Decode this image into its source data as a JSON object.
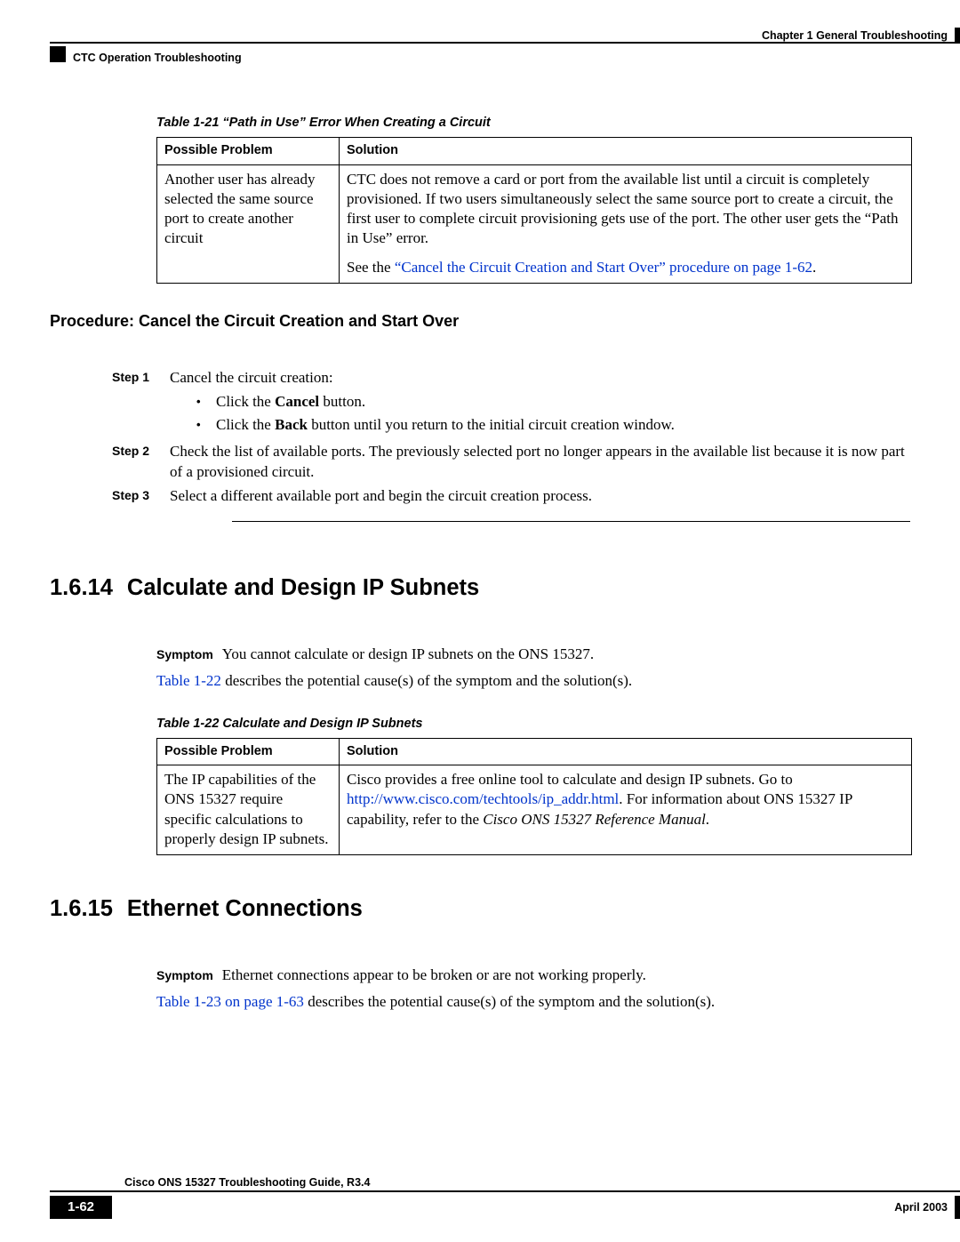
{
  "header": {
    "chapter": "Chapter 1      General Troubleshooting",
    "section": "CTC Operation Troubleshooting"
  },
  "table21": {
    "caption": "Table 1-21    “Path in Use” Error When Creating a Circuit",
    "th1": "Possible Problem",
    "th2": "Solution",
    "problem": "Another user has already selected the same source port to create another circuit",
    "solution1": "CTC does not remove a card or port from the available list until a circuit is completely provisioned. If two users simultaneously select the same source port to create a circuit, the first user to complete circuit provisioning gets use of the port. The other user gets the “Path in Use” error.",
    "solution2_pre": "See the ",
    "solution2_link": "“Cancel the Circuit Creation and Start Over” procedure on page 1-62",
    "solution2_post": "."
  },
  "procedure": {
    "title": "Procedure: Cancel the Circuit Creation and Start Over",
    "step1_label": "Step 1",
    "step1_text": "Cancel the circuit creation:",
    "step1_b1_pre": "Click the ",
    "step1_b1_bold": "Cancel",
    "step1_b1_post": " button.",
    "step1_b2_pre": "Click the ",
    "step1_b2_bold": "Back",
    "step1_b2_post": " button until you return to the initial circuit creation window.",
    "step2_label": "Step 2",
    "step2_text": "Check the list of available ports. The previously selected port no longer appears in the available list because it is now part of a provisioned circuit.",
    "step3_label": "Step 3",
    "step3_text": "Select a different available port and begin the circuit creation process."
  },
  "section14": {
    "num": "1.6.14",
    "title": "Calculate and Design IP Subnets",
    "symptom_label": "Symptom",
    "symptom_text": "You cannot calculate or design IP subnets on the ONS 15327.",
    "desc_link": "Table 1-22",
    "desc_post": " describes the potential cause(s) of the symptom and the solution(s)."
  },
  "table22": {
    "caption": "Table 1-22    Calculate and Design IP Subnets",
    "th1": "Possible Problem",
    "th2": "Solution",
    "problem": "The IP capabilities of the ONS 15327 require specific calculations to properly design IP subnets.",
    "sol_pre": "Cisco provides a free online tool to calculate and design IP subnets. Go to ",
    "sol_link": "http://www.cisco.com/techtools/ip_addr.html",
    "sol_mid": ". For information about ONS 15327 IP capability, refer to the ",
    "sol_em": "Cisco ONS 15327 Reference Manual",
    "sol_post": "."
  },
  "section15": {
    "num": "1.6.15",
    "title": "Ethernet Connections",
    "symptom_label": "Symptom",
    "symptom_text": "Ethernet connections appear to be broken or are not working properly.",
    "desc_link": "Table 1-23 on page 1-63",
    "desc_post": " describes the potential cause(s) of the symptom and the solution(s)."
  },
  "footer": {
    "title": "Cisco ONS 15327 Troubleshooting Guide, R3.4",
    "page": "1-62",
    "date": "April 2003"
  }
}
